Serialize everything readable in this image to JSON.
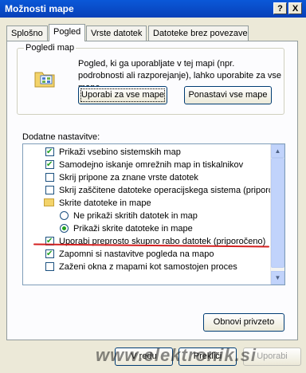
{
  "window": {
    "title": "Možnosti mape",
    "help_label": "?",
    "close_label": "X"
  },
  "tabs": [
    {
      "label": "Splošno"
    },
    {
      "label": "Pogled"
    },
    {
      "label": "Vrste datotek"
    },
    {
      "label": "Datoteke brez povezave"
    }
  ],
  "active_tab": "Pogled",
  "folder_views": {
    "group_label": "Pogledi map",
    "description": "Pogled, ki ga uporabljate v tej mapi (npr. podrobnosti ali razporejanje), lahko uporabite za vse mape.",
    "apply_all_label": "Uporabi za vse mape",
    "reset_all_label": "Ponastavi vse mape"
  },
  "advanced": {
    "label": "Dodatne nastavitve:",
    "items": [
      {
        "type": "checkbox",
        "checked": true,
        "label": "Prikaži vsebino sistemskih map"
      },
      {
        "type": "checkbox",
        "checked": true,
        "label": "Samodejno iskanje omrežnih map in tiskalnikov"
      },
      {
        "type": "checkbox",
        "checked": false,
        "label": "Skrij pripone za znane vrste datotek"
      },
      {
        "type": "checkbox",
        "checked": false,
        "label": "Skrij zaščitene datoteke operacijskega sistema (priporoče"
      },
      {
        "type": "folder",
        "label": "Skrite datoteke in mape"
      },
      {
        "type": "radio",
        "checked": false,
        "label": "Ne prikaži skritih datotek in map"
      },
      {
        "type": "radio",
        "checked": true,
        "label": "Prikaži skrite datoteke in mape"
      },
      {
        "type": "checkbox",
        "checked": true,
        "label": "Uporabi preprosto skupno rabo datotek (priporočeno)"
      },
      {
        "type": "checkbox",
        "checked": true,
        "label": "Zapomni si nastavitve pogleda na mapo"
      },
      {
        "type": "checkbox",
        "checked": false,
        "label": "Zaženi okna z mapami kot samostojen proces"
      }
    ],
    "restore_defaults_label": "Obnovi privzeto"
  },
  "footer": {
    "ok_label": "V redu",
    "cancel_label": "Prekliči",
    "apply_label": "Uporabi"
  },
  "watermark": "www.elektronik.si",
  "colors": {
    "title_bar": "#0a58d8",
    "dialog_bg": "#ece9d8",
    "annotation_red": "#d32020",
    "check_green": "#21a121"
  }
}
